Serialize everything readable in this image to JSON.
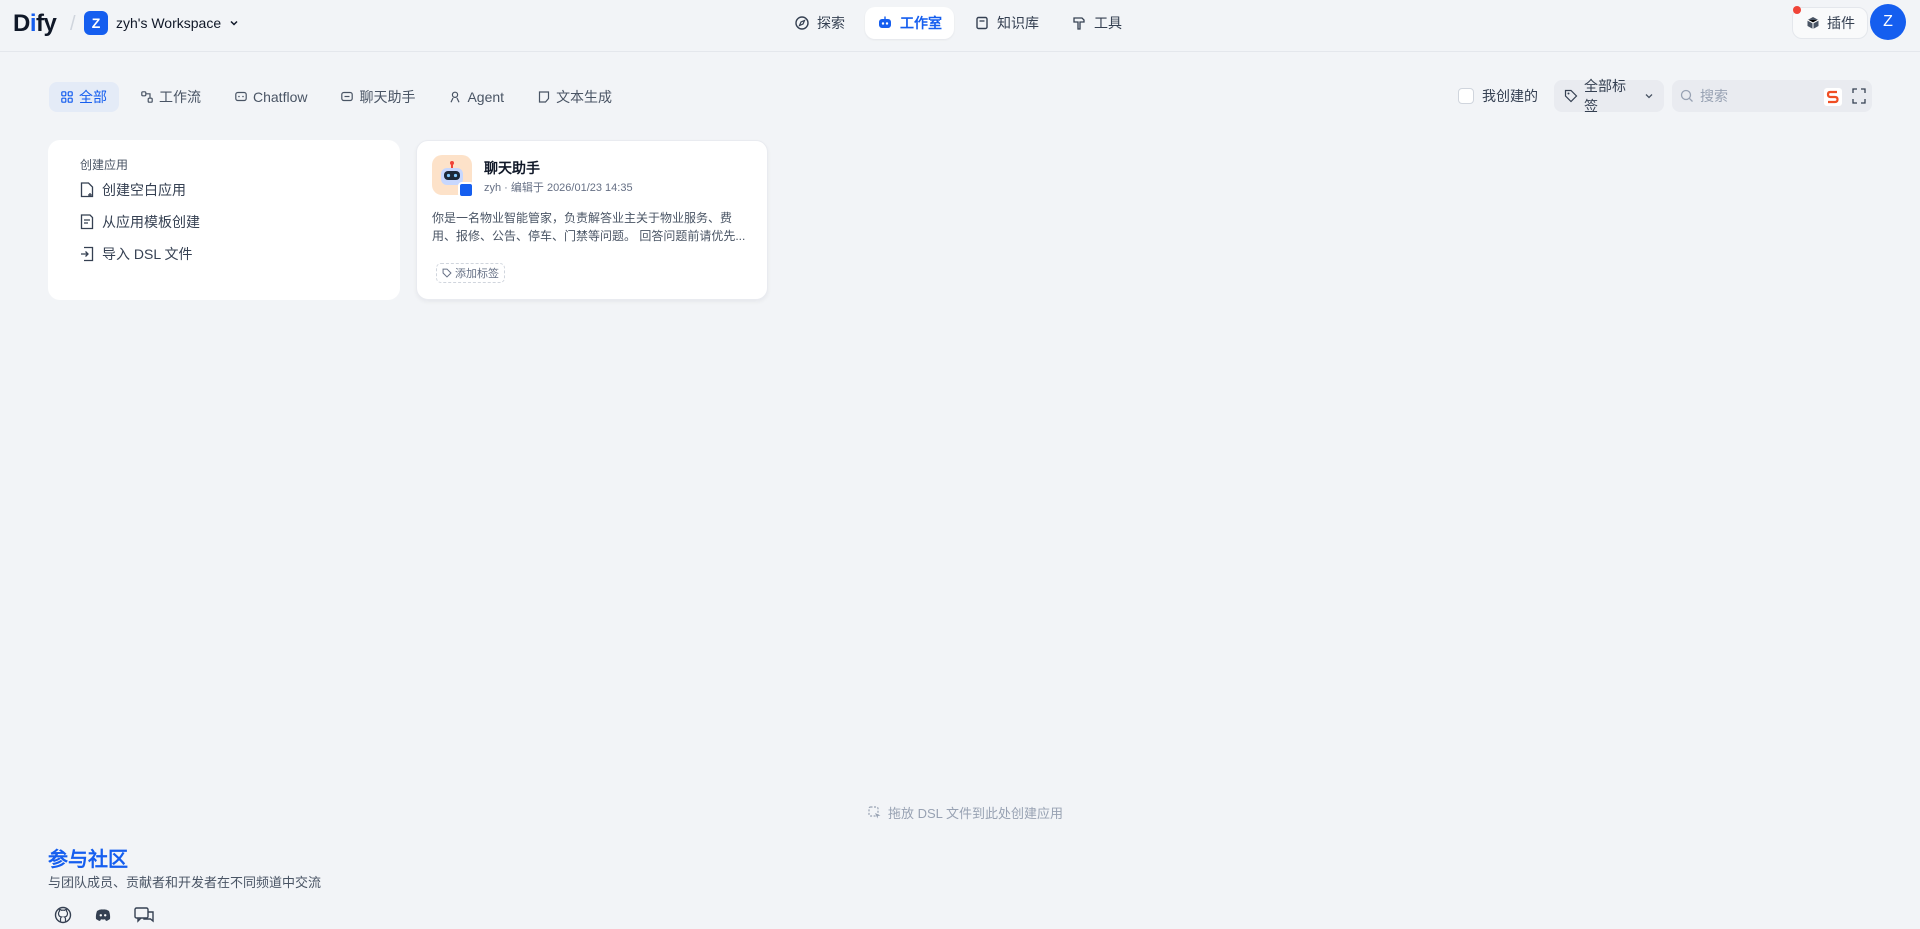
{
  "header": {
    "logo": {
      "part1": "D",
      "part2": "i",
      "part3": "fy"
    },
    "workspace": {
      "initial": "Z",
      "name": "zyh's Workspace"
    },
    "nav": [
      {
        "label": "探索",
        "icon": "compass-icon"
      },
      {
        "label": "工作室",
        "icon": "robot-icon",
        "active": true
      },
      {
        "label": "知识库",
        "icon": "book-icon"
      },
      {
        "label": "工具",
        "icon": "hammer-icon"
      }
    ],
    "plugins_label": "插件",
    "user_initial": "Z"
  },
  "filters": {
    "tabs": [
      {
        "label": "全部",
        "icon": "grid-icon",
        "active": true
      },
      {
        "label": "工作流",
        "icon": "workflow-icon"
      },
      {
        "label": "Chatflow",
        "icon": "chatflow-icon"
      },
      {
        "label": "聊天助手",
        "icon": "chat-icon"
      },
      {
        "label": "Agent",
        "icon": "agent-icon"
      },
      {
        "label": "文本生成",
        "icon": "doc-icon"
      }
    ],
    "mine_label": "我创建的",
    "tag_label": "全部标签",
    "search_placeholder": "搜索"
  },
  "create_card": {
    "title": "创建应用",
    "items": [
      {
        "label": "创建空白应用",
        "icon": "blank-file-icon"
      },
      {
        "label": "从应用模板创建",
        "icon": "template-icon"
      },
      {
        "label": "导入 DSL 文件",
        "icon": "import-icon"
      }
    ]
  },
  "app_card": {
    "name": "聊天助手",
    "meta": "zyh · 编辑于 2026/01/23 14:35",
    "desc_line1": "你是一名物业智能管家，负责解答业主关于物业服务、费",
    "desc_line2": "用、报修、公告、停车、门禁等问题。 回答问题前请优先...",
    "add_tag": "添加标签"
  },
  "drop_hint": "拖放 DSL 文件到此处创建应用",
  "community": {
    "title": "参与社区",
    "subtitle": "与团队成员、贡献者和开发者在不同频道中交流"
  },
  "colors": {
    "accent": "#155eef",
    "background": "#f2f4f7"
  }
}
